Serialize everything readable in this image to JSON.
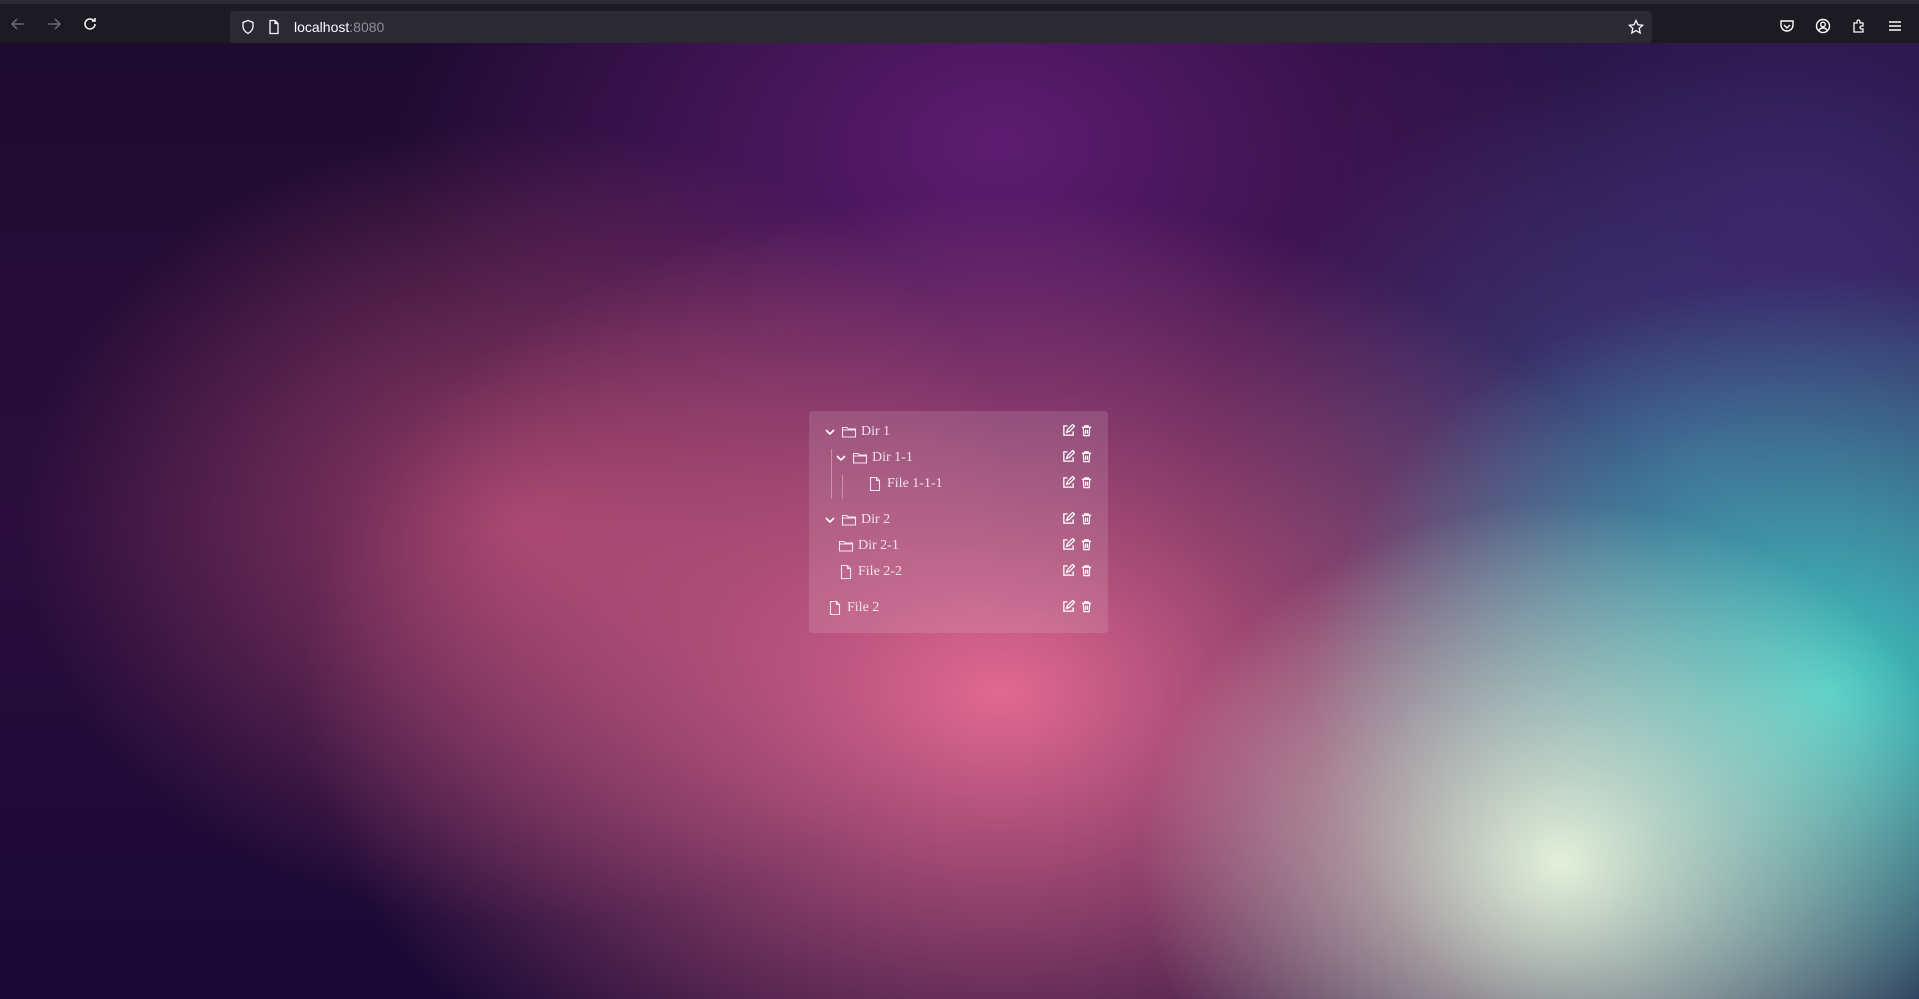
{
  "browser": {
    "url_host": "localhost",
    "url_port": ":8080"
  },
  "tree": [
    {
      "label": "Dir 1",
      "type": "folder",
      "expanded": true,
      "children": [
        {
          "label": "Dir 1-1",
          "type": "folder",
          "expanded": true,
          "children": [
            {
              "label": "File 1-1-1",
              "type": "file"
            }
          ]
        }
      ]
    },
    {
      "label": "Dir 2",
      "type": "folder",
      "expanded": true,
      "children": [
        {
          "label": "Dir 2-1",
          "type": "folder",
          "expanded": false
        },
        {
          "label": "File 2-2",
          "type": "file"
        }
      ]
    },
    {
      "label": "File 2",
      "type": "file"
    }
  ],
  "icons": {
    "expand": "chevron-down-icon",
    "folder": "folder-icon",
    "file": "file-icon",
    "edit": "edit-icon",
    "delete": "trash-icon"
  }
}
